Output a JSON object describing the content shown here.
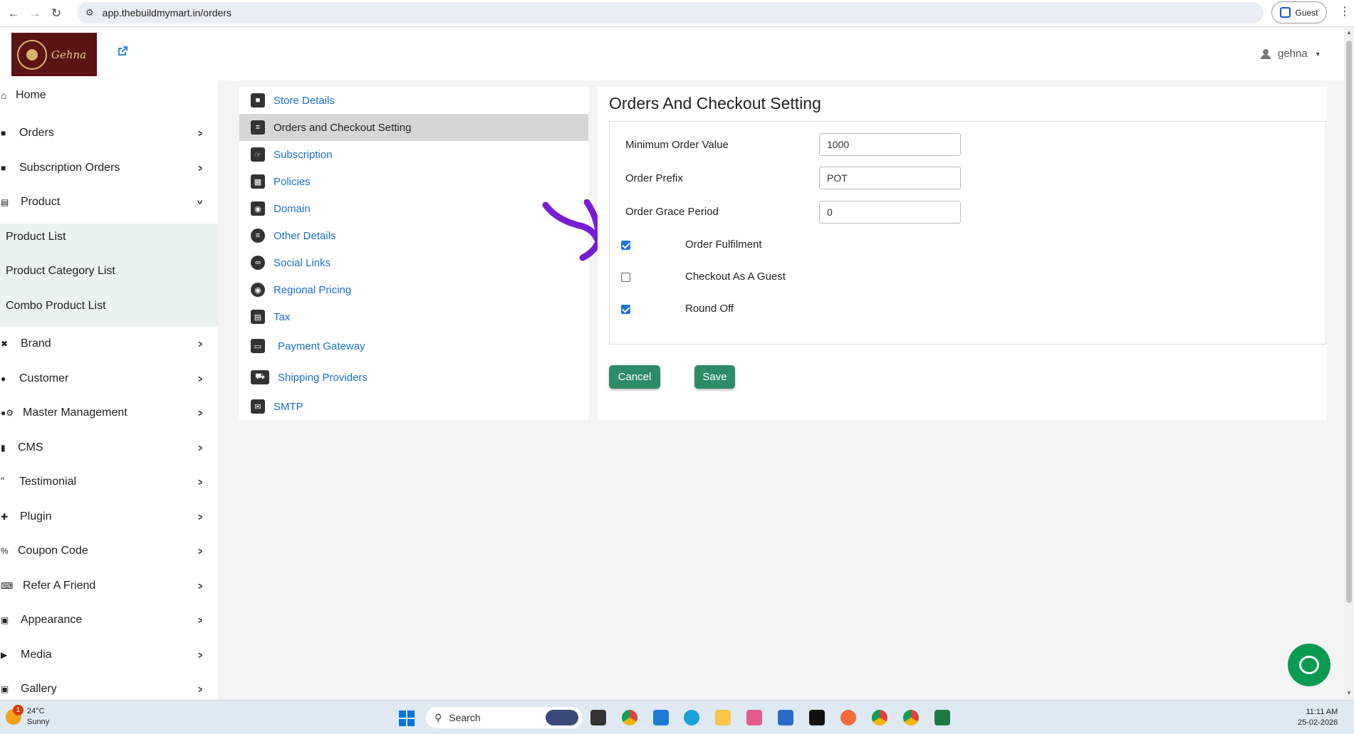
{
  "browser": {
    "url": "app.thebuildmymart.in/orders",
    "guest_label": "Guest"
  },
  "header": {
    "logo_text": "Gehna",
    "user_name": "gehna"
  },
  "sidebar": {
    "items": [
      {
        "label": "Home",
        "icon": "home-icon"
      },
      {
        "label": "Orders",
        "icon": "bag-icon"
      },
      {
        "label": "Subscription Orders",
        "icon": "bag-icon"
      },
      {
        "label": "Product",
        "icon": "box-icon"
      },
      {
        "label": "Brand",
        "icon": "shuffle-icon"
      },
      {
        "label": "Customer",
        "icon": "person-icon"
      },
      {
        "label": "Master Management",
        "icon": "users-gear-icon"
      },
      {
        "label": "CMS",
        "icon": "file-icon"
      },
      {
        "label": "Testimonial",
        "icon": "quote-icon"
      },
      {
        "label": "Plugin",
        "icon": "puzzle-icon"
      },
      {
        "label": "Coupon Code",
        "icon": "percent-icon"
      },
      {
        "label": "Refer A Friend",
        "icon": "keyboard-icon"
      },
      {
        "label": "Appearance",
        "icon": "image-icon"
      },
      {
        "label": "Media",
        "icon": "play-icon"
      },
      {
        "label": "Gallery",
        "icon": "gallery-icon"
      }
    ],
    "product_submenu": [
      "Product List",
      "Product Category List",
      "Combo Product List"
    ]
  },
  "settings_menu": {
    "items": [
      {
        "label": "Store Details",
        "icon": "store-icon"
      },
      {
        "label": "Orders and Checkout Setting",
        "icon": "document-icon"
      },
      {
        "label": "Subscription",
        "icon": "hand-icon"
      },
      {
        "label": "Policies",
        "icon": "policy-icon"
      },
      {
        "label": "Domain",
        "icon": "globe-icon"
      },
      {
        "label": "Other Details",
        "icon": "list-icon"
      },
      {
        "label": "Social Links",
        "icon": "link-icon"
      },
      {
        "label": "Regional Pricing",
        "icon": "regional-pricing-icon"
      },
      {
        "label": "Tax",
        "icon": "receipt-icon"
      },
      {
        "label": "Payment Gateway",
        "icon": "payment-icon"
      },
      {
        "label": "Shipping Providers",
        "icon": "truck-icon"
      },
      {
        "label": "SMTP",
        "icon": "mail-icon"
      }
    ],
    "active": "Orders and Checkout Setting"
  },
  "main": {
    "title": "Orders And Checkout Setting",
    "fields": [
      {
        "label": "Minimum Order Value",
        "value": "1000"
      },
      {
        "label": "Order Prefix",
        "value": "POT"
      },
      {
        "label": "Order Grace Period",
        "value": "0"
      }
    ],
    "checkboxes": [
      {
        "label": "Order Fulfilment",
        "checked": true
      },
      {
        "label": "Checkout As A Guest",
        "checked": false
      },
      {
        "label": "Round Off",
        "checked": true
      }
    ],
    "cancel_label": "Cancel",
    "save_label": "Save"
  },
  "taskbar": {
    "temperature": "24°C",
    "condition": "Sunny",
    "notification_count": "1",
    "search_placeholder": "Search",
    "time": "11:11 AM",
    "date": "25-02-2026"
  },
  "colors": {
    "accent_green": "#2e8b68",
    "link_blue": "#1a6fc9",
    "annotation_purple": "#7a1bd6",
    "chat_green": "#0b9a52"
  }
}
